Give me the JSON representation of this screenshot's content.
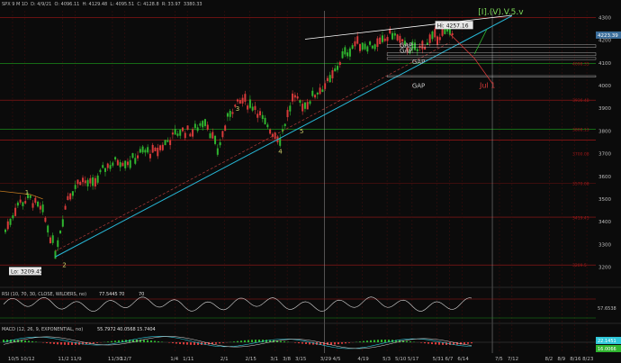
{
  "header": {
    "symbol": "SPX 9 M 1D",
    "date": "D: 4/9/21",
    "open": "O: 4096.11",
    "high": "H: 4129.48",
    "low": "L: 4095.51",
    "close": "C: 4128.8",
    "range": "R: 33.97",
    "last": "3380.33"
  },
  "colors": {
    "background": "#0b0b0b",
    "up": "#2fb52f",
    "down": "#d83a3a",
    "trendline": "#27b7d6",
    "channel": "#ffffff",
    "fib_red": "#a01818",
    "fib_green": "#1b8a1b",
    "price_tag_blue": "#3a6d9a",
    "rsi_line": "#d9d9d9",
    "macd_line": "#2fc7d9",
    "signal_line": "#e0e0e0"
  },
  "chart_data": [
    {
      "type": "candlestick",
      "title": "",
      "x_tick_labels": [
        "10/5",
        "10/12",
        "11/2",
        "11/9",
        "11/30",
        "12/7",
        "1/4",
        "1/11",
        "2/1",
        "2/15",
        "3/1",
        "3/8",
        "3/15",
        "3/29",
        "4/5",
        "4/19",
        "5/3",
        "5/10",
        "5/17",
        "5/31",
        "6/7",
        "6/14",
        "7/5",
        "7/12",
        "8/2",
        "8/9",
        "8/16",
        "8/23"
      ],
      "y_tick_labels": [
        "4300",
        "4200",
        "4100",
        "4000",
        "3900",
        "3800",
        "3700",
        "3600",
        "3500",
        "3400",
        "3300",
        "3200"
      ],
      "ylim": [
        3170,
        4330
      ],
      "x_range": [
        "10/1",
        "8/27"
      ],
      "series": [
        {
          "x": [
            "10/1",
            "10/8",
            "10/15",
            "10/22",
            "10/29",
            "11/5",
            "11/12",
            "11/19",
            "11/26",
            "12/3",
            "12/10",
            "12/17",
            "12/24",
            "12/31",
            "1/7",
            "1/14",
            "1/21",
            "1/28",
            "2/4",
            "2/11",
            "2/18",
            "2/25",
            "3/4",
            "3/11",
            "3/18",
            "3/25",
            "4/1",
            "4/8",
            "4/15",
            "4/22",
            "4/29",
            "5/6",
            "5/13",
            "5/20",
            "5/27",
            "6/3",
            "6/10"
          ],
          "close": [
            3360,
            3480,
            3500,
            3440,
            3269,
            3510,
            3585,
            3560,
            3640,
            3670,
            3665,
            3710,
            3703,
            3756,
            3800,
            3795,
            3853,
            3714,
            3886,
            3934,
            3906,
            3811,
            3768,
            3939,
            3913,
            3974,
            4019,
            4128,
            4185,
            4180,
            4181,
            4232,
            4173,
            4156,
            4200,
            4229,
            4247
          ],
          "name": ""
        }
      ],
      "annotations": {
        "high_label": "Hi: 4257.16",
        "low_label": "Lo: 3209.45",
        "price_tag": "4223.39",
        "wave_count": "[I].(V).V.5.v",
        "wave_labels": [
          "1",
          "2",
          "3",
          "4",
          "5"
        ],
        "gap_labels": [
          "GAP",
          "GAP",
          "GAP",
          "GAP"
        ],
        "date_note": "Jul 1",
        "right_values": [
          "4098.33",
          "3936.48",
          "3808.13",
          "3700.08",
          "3570.08",
          "3419.45",
          "3209.5"
        ]
      }
    },
    {
      "type": "line",
      "title": "RSI (10, 70, 30, CLOSE, WILDERS, no)",
      "legend_values": [
        "77.5445",
        "70",
        "70"
      ],
      "side_label": "57.6538",
      "ylim": [
        0,
        100
      ]
    },
    {
      "type": "bar",
      "title": "MACD (12, 26, 9, EXPONENTIAL, no)",
      "legend_values": [
        "55.7972",
        "40.0568",
        "15.7404"
      ],
      "side_labels": [
        "22.1451",
        "16.0066"
      ]
    }
  ]
}
